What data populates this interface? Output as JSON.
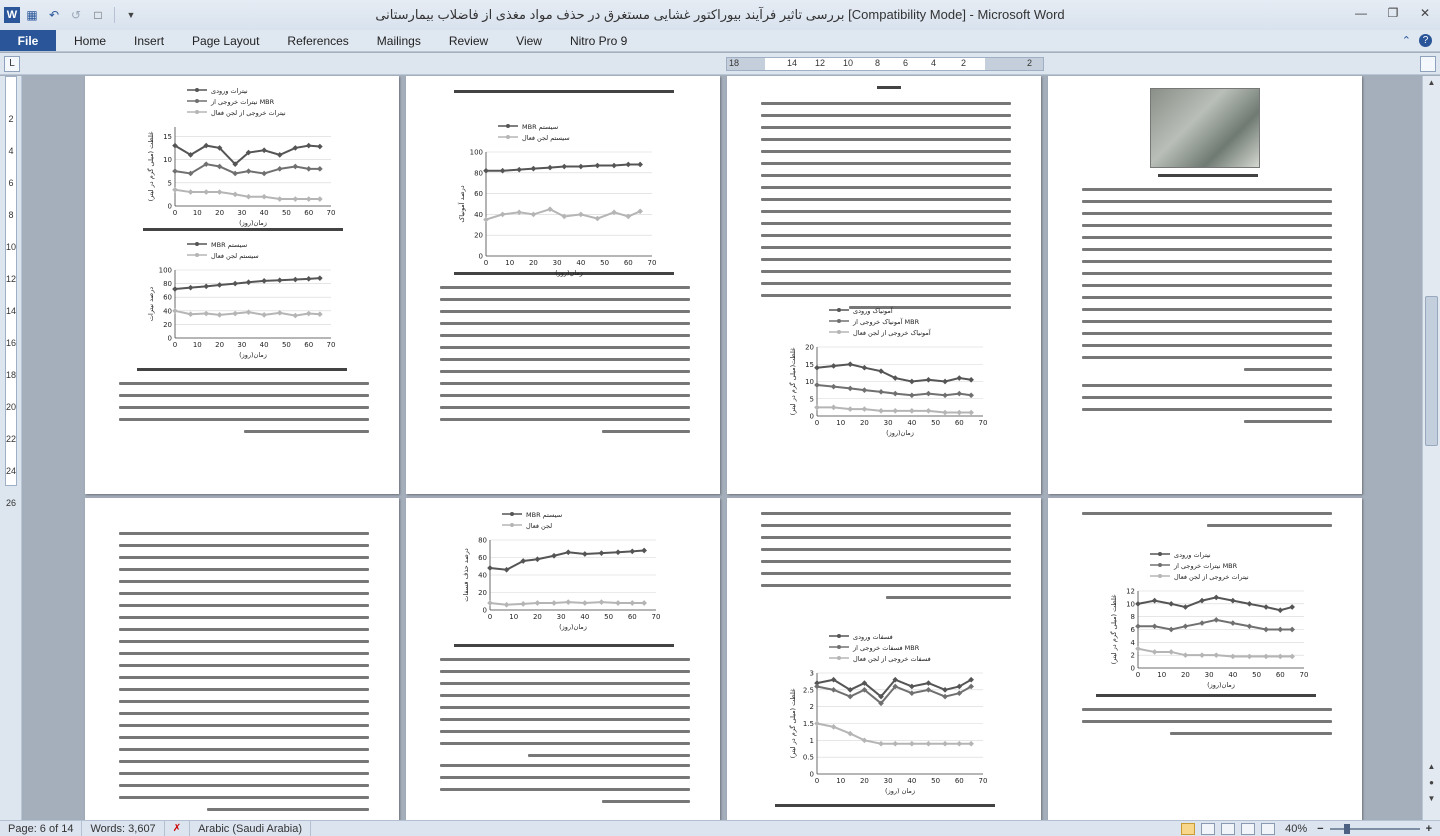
{
  "window": {
    "title": "بررسی تاثیر فرآیند بیوراکتور غشایی مستغرق در حذف مواد مغذی از فاضلاب بیمارستانی [Compatibility Mode]  -  Microsoft Word",
    "app_icon": "W"
  },
  "ribbon": {
    "file_label": "File",
    "tabs": [
      "Home",
      "Insert",
      "Page Layout",
      "References",
      "Mailings",
      "Review",
      "View",
      "Nitro Pro 9"
    ]
  },
  "ruler": {
    "h_numbers": [
      "18",
      "14",
      "12",
      "10",
      "8",
      "6",
      "4",
      "2",
      "2"
    ],
    "v_numbers": [
      "2",
      "4",
      "6",
      "8",
      "10",
      "12",
      "14",
      "16",
      "18",
      "20",
      "22",
      "24",
      "26"
    ]
  },
  "status": {
    "page": "Page: 6 of 14",
    "words": "Words: 3,607",
    "language": "Arabic (Saudi Arabia)",
    "zoom": "40%",
    "zoom_fraction": 0.4
  },
  "charts": {
    "p1a": {
      "legend": [
        "نیترات ورودی",
        "نیترات خروجی از MBR",
        "نیترات خروجی از لجن فعال"
      ],
      "xlabel": "زمان(روز)",
      "ylabel": "غلظت (میلی گرم در لیتر)",
      "yticks": [
        "0",
        "5",
        "10",
        "15"
      ],
      "xticks": [
        "0",
        "10",
        "20",
        "30",
        "40",
        "50",
        "60",
        "70"
      ],
      "ymax": 17,
      "xmax": 70,
      "series": [
        {
          "color": "#555555",
          "x": [
            0,
            7,
            14,
            20,
            27,
            33,
            40,
            47,
            54,
            60,
            65
          ],
          "y": [
            13,
            11,
            13,
            12.5,
            9,
            11.5,
            12,
            11,
            12.5,
            13,
            12.8
          ]
        },
        {
          "color": "#707070",
          "x": [
            0,
            7,
            14,
            20,
            27,
            33,
            40,
            47,
            54,
            60,
            65
          ],
          "y": [
            7.5,
            7,
            9,
            8.5,
            7,
            7.5,
            7,
            8,
            8.5,
            8,
            8
          ]
        },
        {
          "color": "#b5b5b5",
          "x": [
            0,
            7,
            14,
            20,
            27,
            33,
            40,
            47,
            54,
            60,
            65
          ],
          "y": [
            3.5,
            3,
            3,
            3,
            2.5,
            2,
            2,
            1.5,
            1.5,
            1.5,
            1.5
          ]
        }
      ]
    },
    "p1b": {
      "legend": [
        "MBR سیستم",
        "سیستم لجن فعال"
      ],
      "xlabel": "زمان(روز)",
      "ylabel": "درصد نیترات",
      "yticks": [
        "0",
        "20",
        "40",
        "60",
        "80",
        "100"
      ],
      "xticks": [
        "0",
        "10",
        "20",
        "30",
        "40",
        "50",
        "60",
        "70"
      ],
      "ymax": 100,
      "xmax": 70,
      "series": [
        {
          "color": "#555555",
          "x": [
            0,
            7,
            14,
            20,
            27,
            33,
            40,
            47,
            54,
            60,
            65
          ],
          "y": [
            72,
            74,
            76,
            78,
            80,
            82,
            84,
            85,
            86,
            87,
            88
          ]
        },
        {
          "color": "#b5b5b5",
          "x": [
            0,
            7,
            14,
            20,
            27,
            33,
            40,
            47,
            54,
            60,
            65
          ],
          "y": [
            40,
            35,
            36,
            34,
            36,
            38,
            34,
            37,
            33,
            36,
            35
          ]
        }
      ]
    },
    "p2": {
      "legend": [
        "MBR سیستم",
        "سیستم لجن فعال"
      ],
      "xlabel": "زمان(روز)",
      "ylabel": "درصد آمونیاک",
      "yticks": [
        "0",
        "20",
        "40",
        "60",
        "80",
        "100"
      ],
      "xticks": [
        "0",
        "10",
        "20",
        "30",
        "40",
        "50",
        "60",
        "70"
      ],
      "ymax": 100,
      "xmax": 70,
      "series": [
        {
          "color": "#555555",
          "x": [
            0,
            7,
            14,
            20,
            27,
            33,
            40,
            47,
            54,
            60,
            65
          ],
          "y": [
            82,
            82,
            83,
            84,
            85,
            86,
            86,
            87,
            87,
            88,
            88
          ]
        },
        {
          "color": "#b5b5b5",
          "x": [
            0,
            7,
            14,
            20,
            27,
            33,
            40,
            47,
            54,
            60,
            65
          ],
          "y": [
            35,
            40,
            42,
            40,
            45,
            38,
            40,
            36,
            42,
            38,
            43
          ]
        }
      ]
    },
    "p3": {
      "legend": [
        "آمونیاک ورودی",
        "آمونیاک خروجی از MBR",
        "آمونیاک خروجی از لجن فعال"
      ],
      "xlabel": "زمان(روز)",
      "ylabel": "غلظت(میلی گرم در لیتر)",
      "yticks": [
        "0",
        "5",
        "10",
        "15",
        "20"
      ],
      "xticks": [
        "0",
        "10",
        "20",
        "30",
        "40",
        "50",
        "60",
        "70"
      ],
      "ymax": 20,
      "xmax": 70,
      "series": [
        {
          "color": "#555555",
          "x": [
            0,
            7,
            14,
            20,
            27,
            33,
            40,
            47,
            54,
            60,
            65
          ],
          "y": [
            14,
            14.5,
            15,
            14,
            13,
            11,
            10,
            10.5,
            10,
            11,
            10.5
          ]
        },
        {
          "color": "#707070",
          "x": [
            0,
            7,
            14,
            20,
            27,
            33,
            40,
            47,
            54,
            60,
            65
          ],
          "y": [
            9,
            8.5,
            8,
            7.5,
            7,
            6.5,
            6,
            6.5,
            6,
            6.5,
            6
          ]
        },
        {
          "color": "#b5b5b5",
          "x": [
            0,
            7,
            14,
            20,
            27,
            33,
            40,
            47,
            54,
            60,
            65
          ],
          "y": [
            2.5,
            2.5,
            2,
            2,
            1.5,
            1.5,
            1.5,
            1.5,
            1,
            1,
            1
          ]
        }
      ]
    },
    "p5": {
      "legend": [
        "MBR سیستم",
        "لجن فعال"
      ],
      "xlabel": "زمان(روز)",
      "ylabel": "درصد حذف فسفات",
      "yticks": [
        "0",
        "20",
        "40",
        "60",
        "80"
      ],
      "xticks": [
        "0",
        "10",
        "20",
        "30",
        "40",
        "50",
        "60",
        "70"
      ],
      "ymax": 80,
      "xmax": 70,
      "series": [
        {
          "color": "#555555",
          "x": [
            0,
            7,
            14,
            20,
            27,
            33,
            40,
            47,
            54,
            60,
            65
          ],
          "y": [
            48,
            46,
            56,
            58,
            62,
            66,
            64,
            65,
            66,
            67,
            68
          ]
        },
        {
          "color": "#b5b5b5",
          "x": [
            0,
            7,
            14,
            20,
            27,
            33,
            40,
            47,
            54,
            60,
            65
          ],
          "y": [
            8,
            6,
            7,
            8,
            8,
            9,
            8,
            9,
            8,
            8,
            8
          ]
        }
      ]
    },
    "p6": {
      "legend": [
        "فسفات ورودی",
        "فسفات خروجی از MBR",
        "فسفات خروجی از لجن فعال"
      ],
      "xlabel": "زمان (روز)",
      "ylabel": "غلظت (میلی گرم در لیتر)",
      "yticks": [
        "0",
        "0.5",
        "1",
        "1.5",
        "2",
        "2.5",
        "3"
      ],
      "xticks": [
        "0",
        "10",
        "20",
        "30",
        "40",
        "50",
        "60",
        "70"
      ],
      "ymax": 3,
      "xmax": 70,
      "series": [
        {
          "color": "#555555",
          "x": [
            0,
            7,
            14,
            20,
            27,
            33,
            40,
            47,
            54,
            60,
            65
          ],
          "y": [
            2.7,
            2.8,
            2.5,
            2.7,
            2.3,
            2.8,
            2.6,
            2.7,
            2.5,
            2.6,
            2.8
          ]
        },
        {
          "color": "#707070",
          "x": [
            0,
            7,
            14,
            20,
            27,
            33,
            40,
            47,
            54,
            60,
            65
          ],
          "y": [
            2.6,
            2.5,
            2.3,
            2.5,
            2.1,
            2.6,
            2.4,
            2.5,
            2.3,
            2.4,
            2.6
          ]
        },
        {
          "color": "#b5b5b5",
          "x": [
            0,
            7,
            14,
            20,
            27,
            33,
            40,
            47,
            54,
            60,
            65
          ],
          "y": [
            1.5,
            1.4,
            1.2,
            1,
            0.9,
            0.9,
            0.9,
            0.9,
            0.9,
            0.9,
            0.9
          ]
        }
      ]
    },
    "p7": {
      "legend": [
        "نیترات ورودی",
        "نیترات خروجی از MBR",
        "نیترات خروجی از لجن فعال"
      ],
      "xlabel": "زمان(روز)",
      "ylabel": "غلظت (میلی گرم در لیتر)",
      "yticks": [
        "0",
        "2",
        "4",
        "6",
        "8",
        "10",
        "12"
      ],
      "xticks": [
        "0",
        "10",
        "20",
        "30",
        "40",
        "50",
        "60",
        "70"
      ],
      "ymax": 12,
      "xmax": 70,
      "series": [
        {
          "color": "#555555",
          "x": [
            0,
            7,
            14,
            20,
            27,
            33,
            40,
            47,
            54,
            60,
            65
          ],
          "y": [
            10,
            10.5,
            10,
            9.5,
            10.5,
            11,
            10.5,
            10,
            9.5,
            9,
            9.5
          ]
        },
        {
          "color": "#707070",
          "x": [
            0,
            7,
            14,
            20,
            27,
            33,
            40,
            47,
            54,
            60,
            65
          ],
          "y": [
            6.5,
            6.5,
            6,
            6.5,
            7,
            7.5,
            7,
            6.5,
            6,
            6,
            6
          ]
        },
        {
          "color": "#b5b5b5",
          "x": [
            0,
            7,
            14,
            20,
            27,
            33,
            40,
            47,
            54,
            60,
            65
          ],
          "y": [
            3,
            2.5,
            2.5,
            2,
            2,
            2,
            1.8,
            1.8,
            1.8,
            1.8,
            1.8
          ]
        }
      ]
    }
  }
}
